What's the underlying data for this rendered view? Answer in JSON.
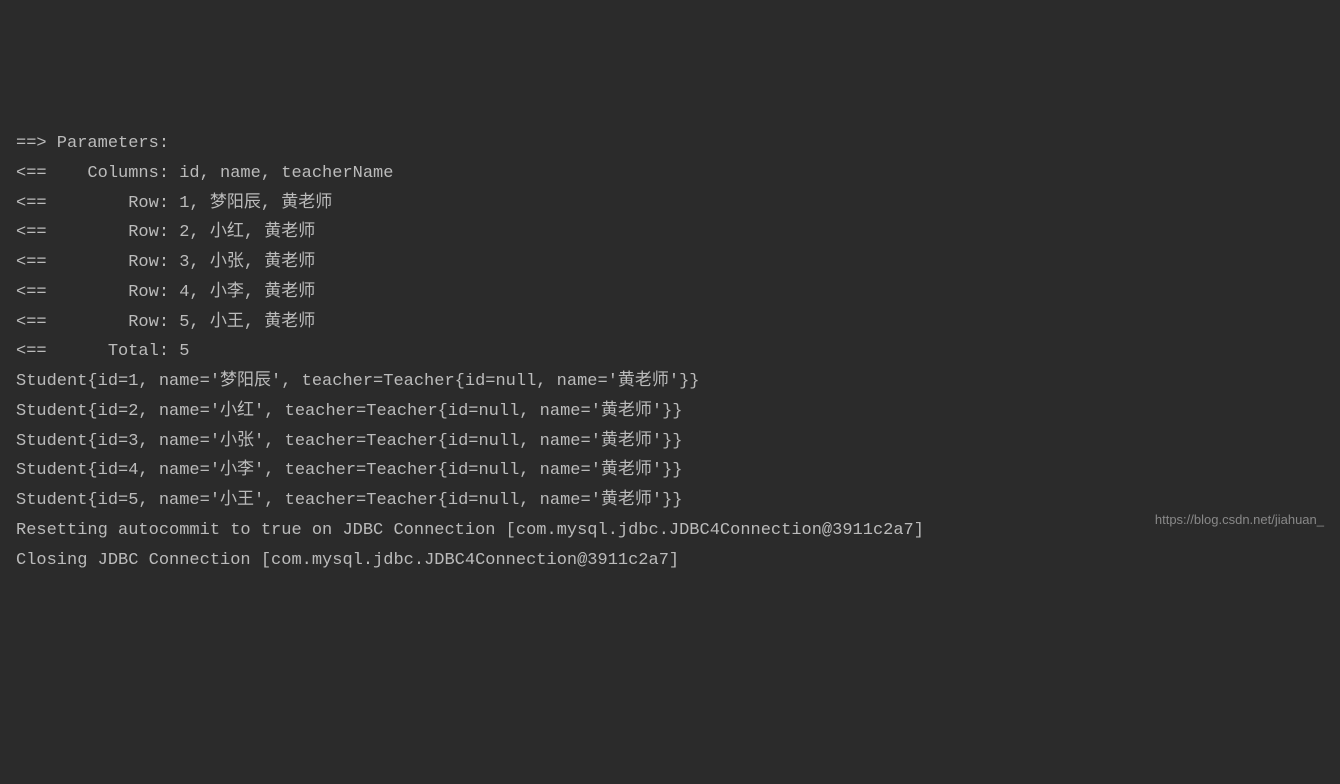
{
  "lines": {
    "l0": "==> Parameters:",
    "l1": "<==    Columns: id, name, teacherName",
    "l2": "<==        Row: 1, 梦阳辰, 黄老师",
    "l3": "<==        Row: 2, 小红, 黄老师",
    "l4": "<==        Row: 3, 小张, 黄老师",
    "l5": "<==        Row: 4, 小李, 黄老师",
    "l6": "<==        Row: 5, 小王, 黄老师",
    "l7": "<==      Total: 5",
    "l8": "Student{id=1, name='梦阳辰', teacher=Teacher{id=null, name='黄老师'}}",
    "l9": "Student{id=2, name='小红', teacher=Teacher{id=null, name='黄老师'}}",
    "l10": "Student{id=3, name='小张', teacher=Teacher{id=null, name='黄老师'}}",
    "l11": "Student{id=4, name='小李', teacher=Teacher{id=null, name='黄老师'}}",
    "l12": "Student{id=5, name='小王', teacher=Teacher{id=null, name='黄老师'}}",
    "l13": "Resetting autocommit to true on JDBC Connection [com.mysql.jdbc.JDBC4Connection@3911c2a7]",
    "l14": "Closing JDBC Connection [com.mysql.jdbc.JDBC4Connection@3911c2a7]"
  },
  "watermark": "https://blog.csdn.net/jiahuan_"
}
